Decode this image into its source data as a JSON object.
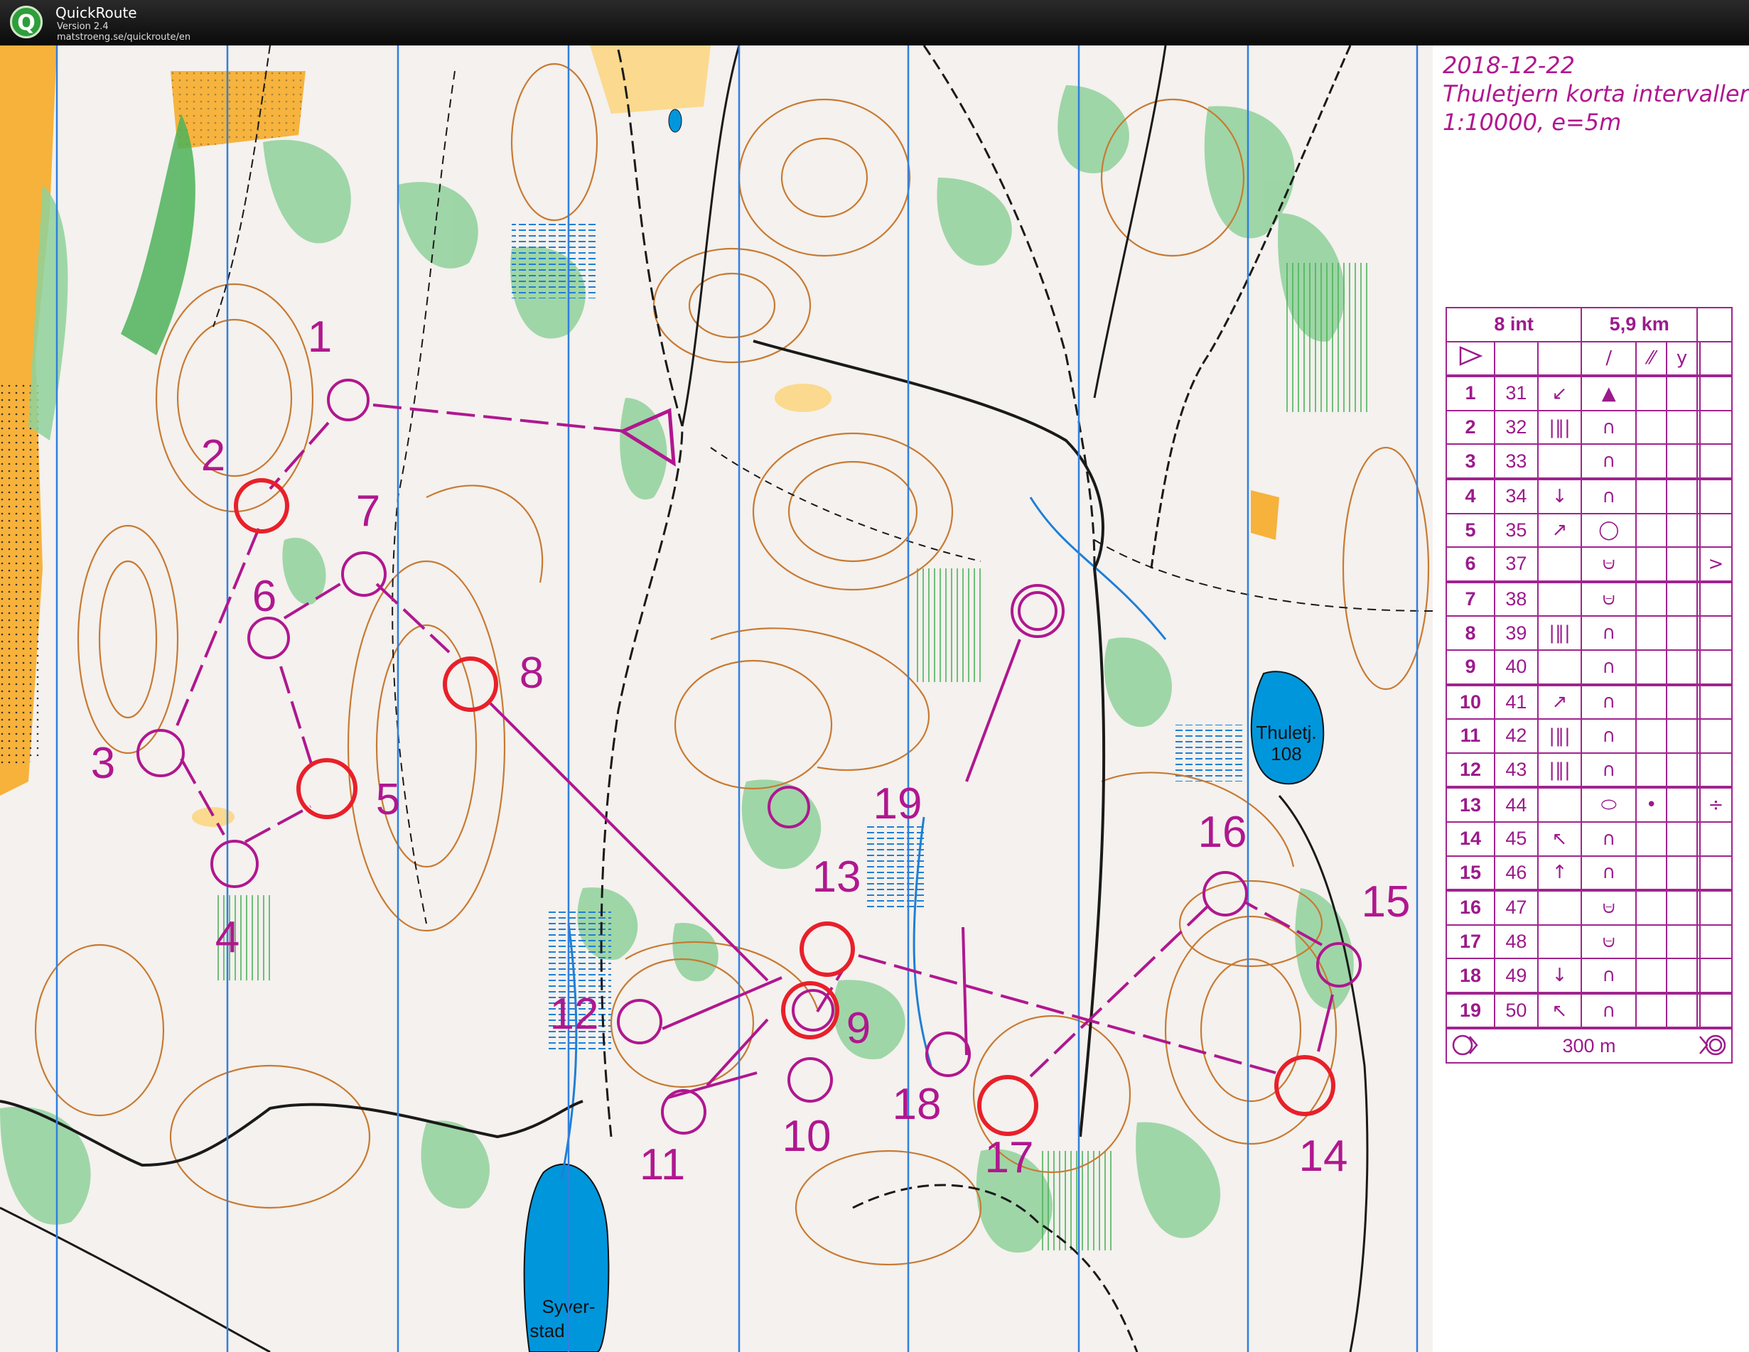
{
  "app": {
    "name": "QuickRoute",
    "version": "Version 2.4",
    "url": "matstroeng.se/quickroute/en",
    "icon": "Q"
  },
  "map": {
    "header": {
      "date": "2018-12-22",
      "title": "Thuletjern korta intervaller",
      "scale": "1:10000, e=5m"
    },
    "lake_labels": [
      "Thuletj.",
      "108",
      "Syver-",
      "stad"
    ],
    "control_numbers": [
      "1",
      "2",
      "3",
      "4",
      "5",
      "6",
      "7",
      "8",
      "9",
      "10",
      "11",
      "12",
      "13",
      "14",
      "15",
      "16",
      "17",
      "18",
      "19"
    ],
    "colors": {
      "course": "#b0178f",
      "route_circle": "#e8202a",
      "forest": "#ffffff",
      "green": "#7ccb86",
      "open_land": "#f7b23b",
      "water": "#0096dc",
      "contour": "#c87a32",
      "north_lines": "#2f7fe0"
    }
  },
  "description_sheet": {
    "header": {
      "course": "8 int",
      "length": "5,9 km"
    },
    "start_symbol": "start-triangle",
    "start_row_symbols": [
      "/",
      "⁄⁄",
      "y"
    ],
    "rows": [
      {
        "num": "1",
        "code": "31",
        "col_c": "↙",
        "col_d": "▲",
        "col_h": ""
      },
      {
        "num": "2",
        "code": "32",
        "col_c": "|‖|",
        "col_d": "∩",
        "col_h": ""
      },
      {
        "num": "3",
        "code": "33",
        "col_c": "",
        "col_d": "∩",
        "col_h": ""
      },
      {
        "num": "4",
        "code": "34",
        "col_c": "↓",
        "col_d": "∩",
        "col_h": ""
      },
      {
        "num": "5",
        "code": "35",
        "col_c": "↗",
        "col_d": "◯",
        "col_h": ""
      },
      {
        "num": "6",
        "code": "37",
        "col_c": "",
        "col_d": "⩁",
        "col_h": ">"
      },
      {
        "num": "7",
        "code": "38",
        "col_c": "",
        "col_d": "⩁",
        "col_h": ""
      },
      {
        "num": "8",
        "code": "39",
        "col_c": "|‖|",
        "col_d": "∩",
        "col_h": ""
      },
      {
        "num": "9",
        "code": "40",
        "col_c": "",
        "col_d": "∩",
        "col_h": ""
      },
      {
        "num": "10",
        "code": "41",
        "col_c": "↗",
        "col_d": "∩",
        "col_h": ""
      },
      {
        "num": "11",
        "code": "42",
        "col_c": "|‖|",
        "col_d": "∩",
        "col_h": ""
      },
      {
        "num": "12",
        "code": "43",
        "col_c": "|‖|",
        "col_d": "∩",
        "col_h": ""
      },
      {
        "num": "13",
        "code": "44",
        "col_c": "",
        "col_d": "⬭",
        "col_e": "•",
        "col_h": "÷"
      },
      {
        "num": "14",
        "code": "45",
        "col_c": "↖",
        "col_d": "∩",
        "col_h": ""
      },
      {
        "num": "15",
        "code": "46",
        "col_c": "↑",
        "col_d": "∩",
        "col_h": ""
      },
      {
        "num": "16",
        "code": "47",
        "col_c": "",
        "col_d": "⩁",
        "col_h": ""
      },
      {
        "num": "17",
        "code": "48",
        "col_c": "",
        "col_d": "⩁",
        "col_h": ""
      },
      {
        "num": "18",
        "code": "49",
        "col_c": "↓",
        "col_d": "∩",
        "col_h": ""
      },
      {
        "num": "19",
        "code": "50",
        "col_c": "↖",
        "col_d": "∩",
        "col_h": ""
      }
    ],
    "finish": {
      "distance": "300 m"
    }
  }
}
